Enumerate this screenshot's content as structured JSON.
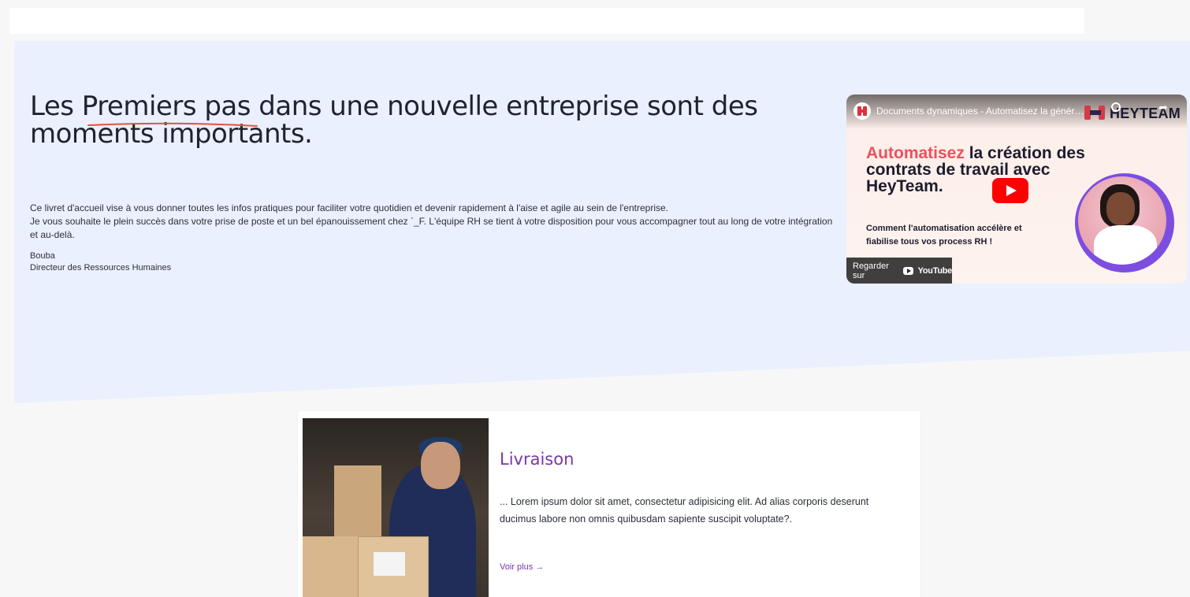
{
  "hero": {
    "headline_part1": "Les ",
    "headline_highlight": "Premiers pas",
    "headline_part2": " dans une nouvelle entreprise sont des moments importants.",
    "intro_line1": "Ce livret d'accueil vise à vous donner toutes les infos pratiques pour faciliter votre quotidien et devenir rapidement à l'aise et agile au sein de l'entreprise.",
    "intro_line2": "Je vous souhaite le plein succès dans votre prise de poste et un bel épanouissement chez `_F. L'équipe RH se tient à votre disposition pour vous accompagner tout au long de votre intégration et au-delà.",
    "signature_name": "Bouba",
    "signature_role": "Directeur des Ressources Humaines",
    "accent_color": "#e0533f",
    "background_color": "#eaf0fd"
  },
  "video": {
    "title": "Documents dynamiques - Automatisez la génération",
    "brand": "HEYTEAM",
    "headline_accent": "Automatisez",
    "headline_rest": " la création des contrats de travail avec HeyTeam.",
    "subtitle": "Comment l'automatisation accélère et fiabilise tous vos process RH !",
    "watch_label": "Regarder sur",
    "youtube_word": "YouTube",
    "accent_color": "#ee4f5c"
  },
  "card": {
    "title": "Livraison",
    "text": "... Lorem ipsum dolor sit amet, consectetur adipisicing elit. Ad alias corporis deserunt ducimus labore non omnis quibusdam sapiente suscipit voluptate?.",
    "link": "Voir plus →",
    "title_color": "#7b36a8"
  }
}
